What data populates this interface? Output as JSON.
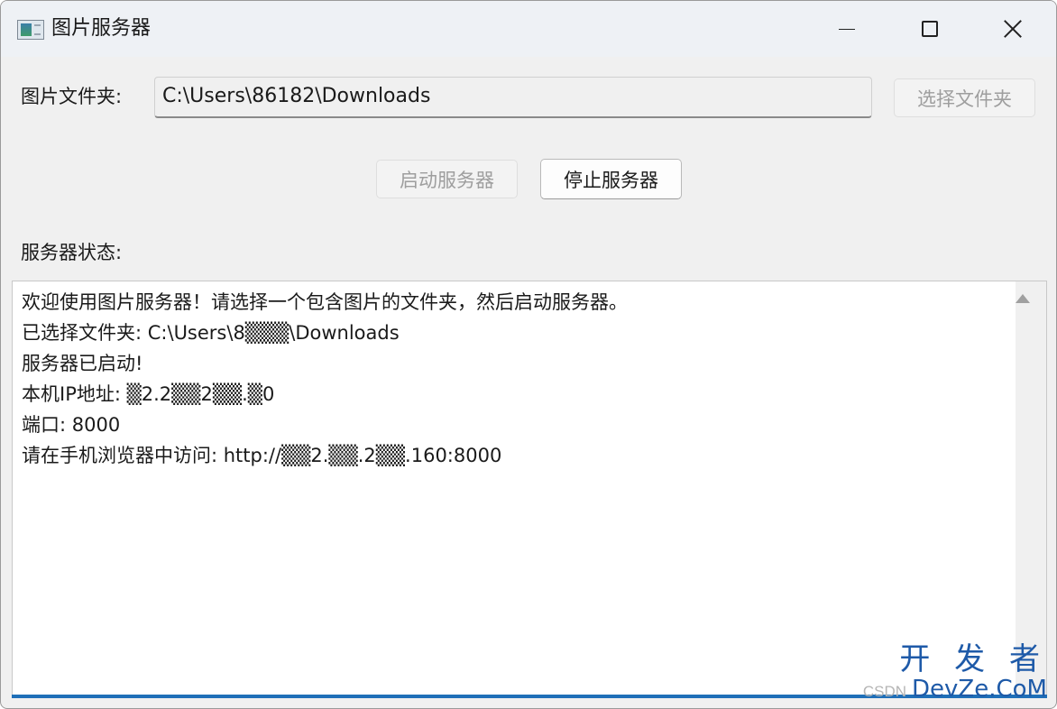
{
  "window": {
    "title": "图片服务器",
    "controls": {
      "minimize": "minimize-icon",
      "maximize": "maximize-icon",
      "close": "close-icon"
    }
  },
  "folder": {
    "label": "图片文件夹:",
    "path": "C:\\Users\\86182\\Downloads",
    "choose_button": "选择文件夹"
  },
  "server": {
    "start_button": "启动服务器",
    "stop_button": "停止服务器"
  },
  "status": {
    "label": "服务器状态:",
    "log": [
      "欢迎使用图片服务器！请选择一个包含图片的文件夹，然后启动服务器。",
      "已选择文件夹: C:\\Users\\8▒▒▒\\Downloads",
      "服务器已启动!",
      "本机IP地址: ▒2.2▒▒2▒▒.▒0",
      "端口: 8000",
      "请在手机浏览器中访问: http://▒▒2.▒▒.2▒▒.160:8000"
    ]
  },
  "watermark": {
    "line1": "开 发 者",
    "prefix": "CSDN",
    "domain": "DevZe.CoM"
  },
  "colors": {
    "accent": "#1f6fb8",
    "window_bg": "#f0f0f0",
    "disabled_text": "#9e9e9e"
  }
}
